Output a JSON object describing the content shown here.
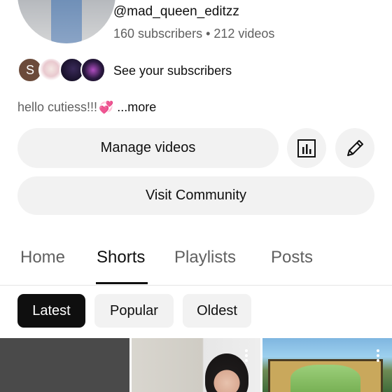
{
  "channel": {
    "handle": "@mad_queen_editzz",
    "stats": "160 subscribers • 212 videos",
    "subscriber_initial": "S",
    "see_subscribers": "See your subscribers",
    "bio_text": "hello cutiess!!!",
    "bio_more": "...more"
  },
  "buttons": {
    "manage_videos": "Manage videos",
    "visit_community": "Visit Community",
    "analytics_icon": "bar-chart-icon",
    "edit_icon": "pencil-icon"
  },
  "tabs": [
    {
      "label": "Home",
      "active": false
    },
    {
      "label": "Shorts",
      "active": true
    },
    {
      "label": "Playlists",
      "active": false
    },
    {
      "label": "Posts",
      "active": false
    }
  ],
  "filters": [
    {
      "label": "Latest",
      "active": true
    },
    {
      "label": "Popular",
      "active": false
    },
    {
      "label": "Oldest",
      "active": false
    }
  ],
  "colors": {
    "primary_text": "#0f0f0f",
    "secondary_text": "#606060",
    "chip_bg": "#f2f2f2",
    "active_chip_bg": "#0f0f0f",
    "heart": "#e83d8a"
  }
}
